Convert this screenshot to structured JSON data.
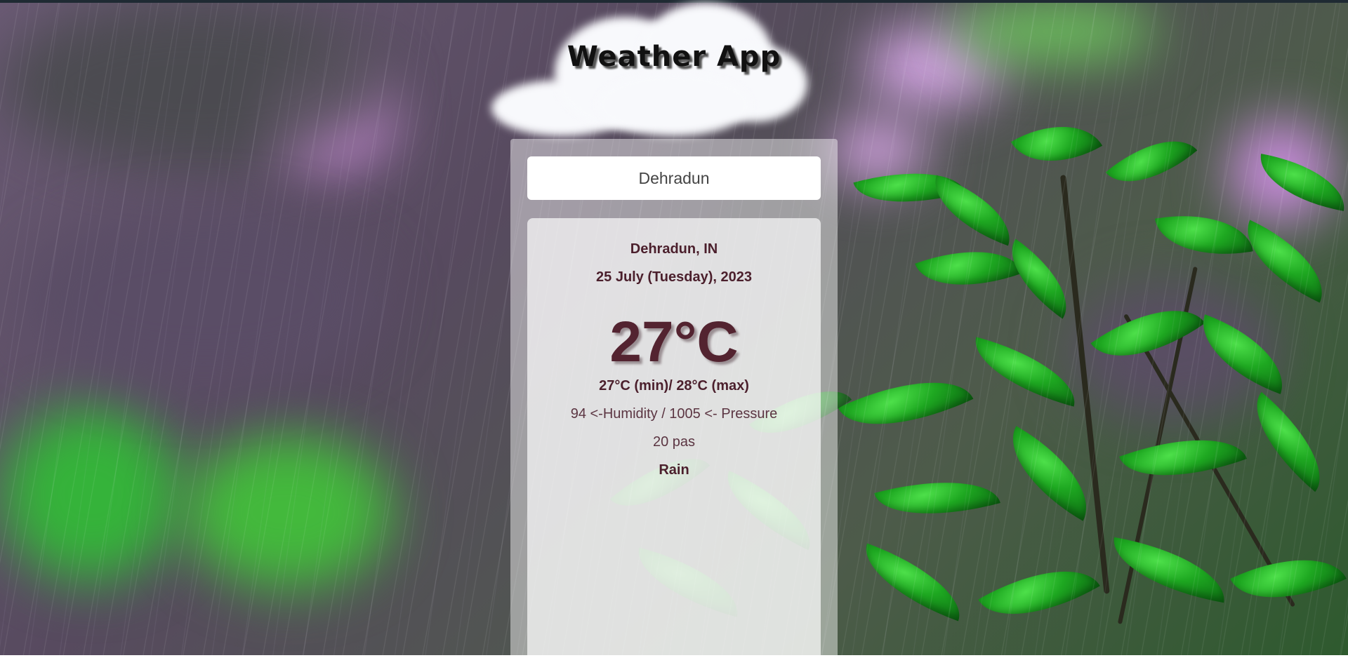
{
  "app": {
    "title": "Weather App"
  },
  "search": {
    "value": "Dehradun"
  },
  "weather": {
    "location": "Dehradun, IN",
    "date": "25 July (Tuesday), 2023",
    "temperature": "27°C",
    "min_max": "27°C (min)/ 28°C (max)",
    "humidity_pressure": "94 <-Humidity / 1005 <- Pressure",
    "wind": "20 pas",
    "condition": "Rain"
  },
  "background": {
    "description_icon": "rain-plant-background"
  }
}
